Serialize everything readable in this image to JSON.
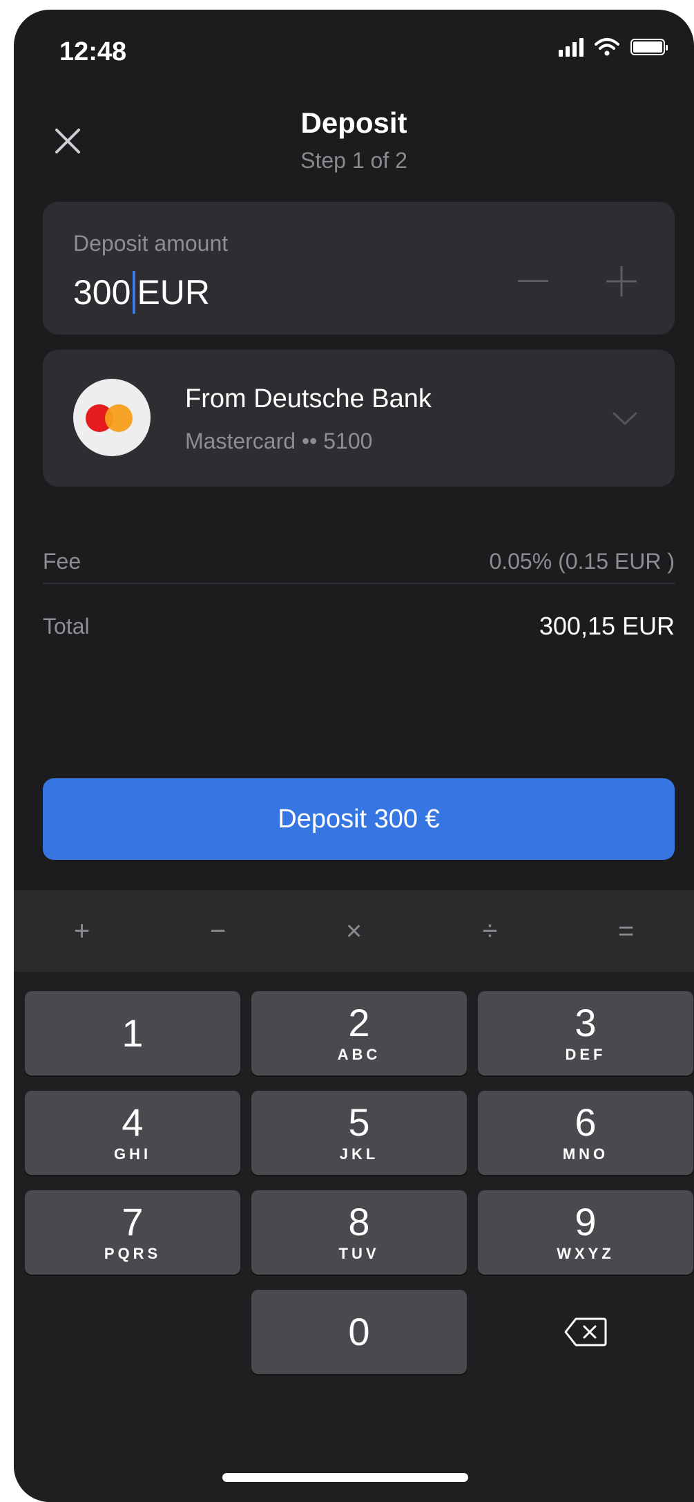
{
  "status_bar": {
    "time": "12:48"
  },
  "header": {
    "title": "Deposit",
    "step": "Step 1 of 2"
  },
  "amount": {
    "label": "Deposit amount",
    "value": "300",
    "currency": "EUR"
  },
  "source": {
    "title": "From Deutsche Bank",
    "subtitle": "Mastercard •• 5100"
  },
  "summary": {
    "fee_label": "Fee",
    "fee_value": "0.05% (0.15 EUR )",
    "total_label": "Total",
    "total_value": "300,15 EUR"
  },
  "cta": {
    "label": "Deposit 300 €"
  },
  "keyboard": {
    "operators": [
      "+",
      "−",
      "×",
      "÷",
      "="
    ],
    "keys": [
      {
        "num": "1",
        "letters": ""
      },
      {
        "num": "2",
        "letters": "ABC"
      },
      {
        "num": "3",
        "letters": "DEF"
      },
      {
        "num": "4",
        "letters": "GHI"
      },
      {
        "num": "5",
        "letters": "JKL"
      },
      {
        "num": "6",
        "letters": "MNO"
      },
      {
        "num": "7",
        "letters": "PQRS"
      },
      {
        "num": "8",
        "letters": "TUV"
      },
      {
        "num": "9",
        "letters": "WXYZ"
      },
      {
        "num": "0",
        "letters": ""
      }
    ]
  },
  "icons": {
    "close": "close-icon",
    "minus": "minus-icon",
    "plus": "plus-icon",
    "chevron": "chevron-down-icon",
    "delete": "backspace-icon",
    "card_brand": "mastercard-logo"
  },
  "colors": {
    "background": "#1c1c1e",
    "card": "#2e2e32",
    "accent": "#3576e3",
    "key": "#4a4a4e",
    "muted_text": "#8d8d92"
  }
}
